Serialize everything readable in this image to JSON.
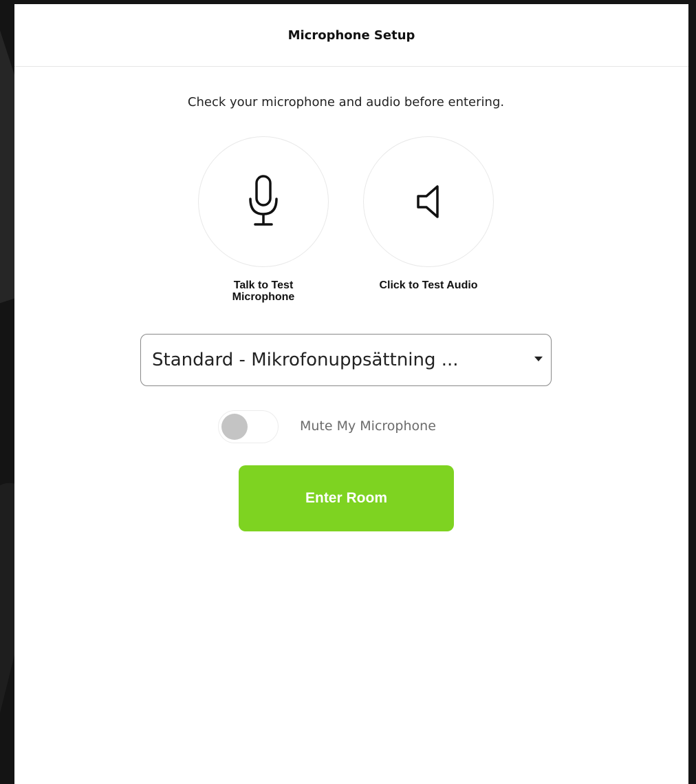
{
  "dialog": {
    "title": "Microphone Setup",
    "subtitle": "Check your microphone and audio before entering."
  },
  "tests": {
    "microphone": {
      "icon": "microphone-icon",
      "label": "Talk to Test Microphone"
    },
    "audio": {
      "icon": "speaker-icon",
      "label": "Click to Test Audio"
    }
  },
  "device_select": {
    "selected_value": "Standard - Mikrofonuppsättning ..."
  },
  "mute_toggle": {
    "label": "Mute My Microphone",
    "checked": false
  },
  "enter_button": {
    "label": "Enter Room",
    "color": "#7ed321"
  }
}
